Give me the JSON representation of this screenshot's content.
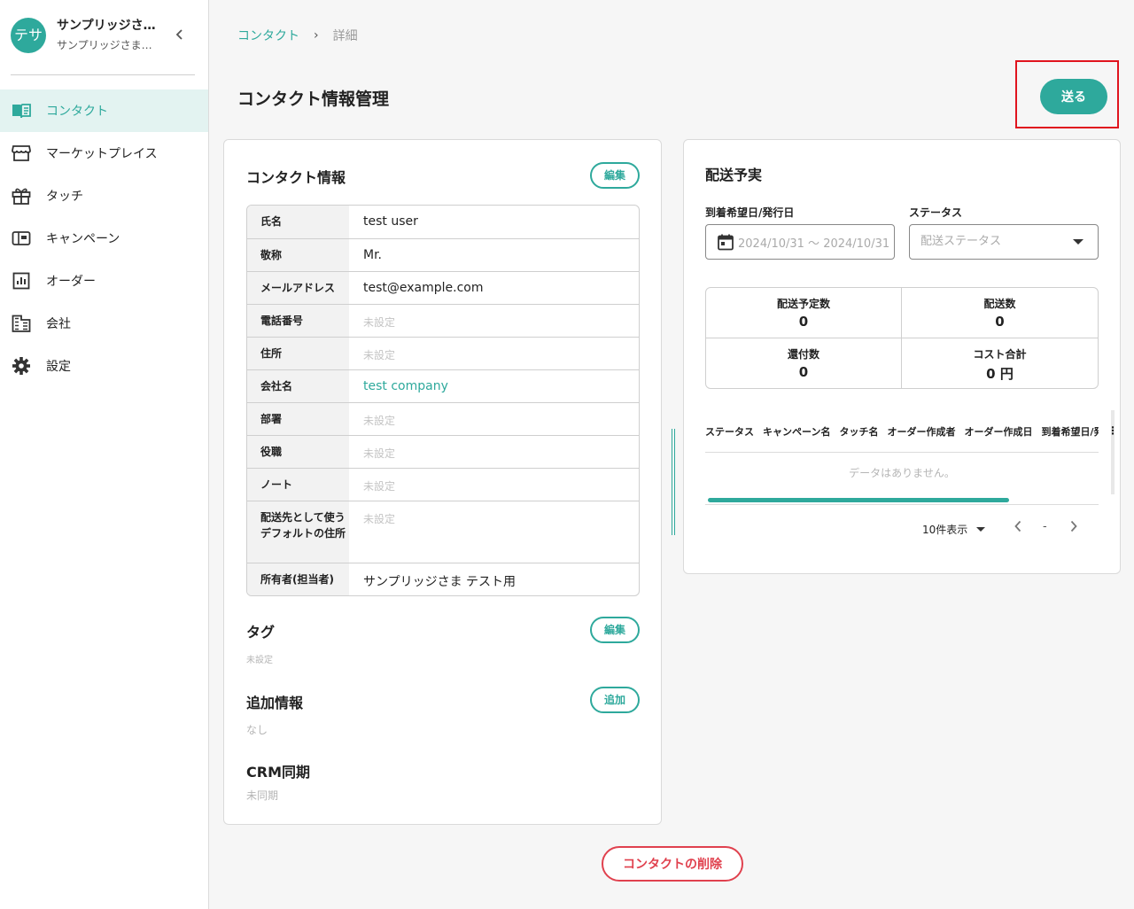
{
  "account": {
    "avatar_text": "テサ",
    "name": "サンプリッジさまテスト用",
    "sub": "サンプリッジさまテスト用"
  },
  "nav": [
    {
      "label": "コンタクト",
      "icon": "book-icon",
      "active": true
    },
    {
      "label": "マーケットプレイス",
      "icon": "store-icon"
    },
    {
      "label": "タッチ",
      "icon": "gift-icon"
    },
    {
      "label": "キャンペーン",
      "icon": "mailbox-icon"
    },
    {
      "label": "オーダー",
      "icon": "bar-chart-icon"
    },
    {
      "label": "会社",
      "icon": "building-icon"
    },
    {
      "label": "設定",
      "icon": "gear-icon"
    }
  ],
  "breadcrumb": {
    "parent": "コンタクト",
    "current": "詳細"
  },
  "page_title": "コンタクト情報管理",
  "send_label": "送る",
  "contact": {
    "title": "コンタクト情報",
    "edit_label": "編集",
    "rows": [
      {
        "label": "氏名",
        "value": "test user"
      },
      {
        "label": "敬称",
        "value": "Mr."
      },
      {
        "label": "メールアドレス",
        "value": "test@example.com"
      },
      {
        "label": "電話番号",
        "value": "未設定"
      },
      {
        "label": "住所",
        "value": "未設定"
      },
      {
        "label": "会社名",
        "value": "test company"
      },
      {
        "label": "部署",
        "value": "未設定"
      },
      {
        "label": "役職",
        "value": "未設定"
      },
      {
        "label": "ノート",
        "value": "未設定"
      },
      {
        "label": "配送先として使うデフォルトの住所",
        "value": "未設定"
      },
      {
        "label": "所有者(担当者)",
        "value": "サンプリッジさま テスト用"
      }
    ]
  },
  "tags": {
    "title": "タグ",
    "edit_label": "編集",
    "value": "未設定"
  },
  "extra": {
    "title": "追加情報",
    "add_label": "追加",
    "value": "なし"
  },
  "crm": {
    "title": "CRM同期",
    "value": "未同期"
  },
  "delivery": {
    "title": "配送予実",
    "date_label": "到着希望日/発行日",
    "date_value": "2024/10/31 〜 2024/10/31",
    "status_label": "ステータス",
    "status_placeholder": "配送ステータス",
    "stats": [
      {
        "label": "配送予定数",
        "value": "0"
      },
      {
        "label": "配送数",
        "value": "0"
      },
      {
        "label": "還付数",
        "value": "0"
      },
      {
        "label": "コスト合計",
        "value": "0 円"
      }
    ],
    "columns": [
      "ステータス",
      "キャンペーン名",
      "タッチ名",
      "オーダー作成者",
      "オーダー作成日",
      "到着希望日/発行日"
    ],
    "no_data": "データはありません。",
    "per_page": "10件表示",
    "page_indicator": "-"
  },
  "delete_label": "コンタクトの削除",
  "colors": {
    "accent": "#2ea99c",
    "danger": "#e0414e",
    "highlight": "#e0141e"
  }
}
